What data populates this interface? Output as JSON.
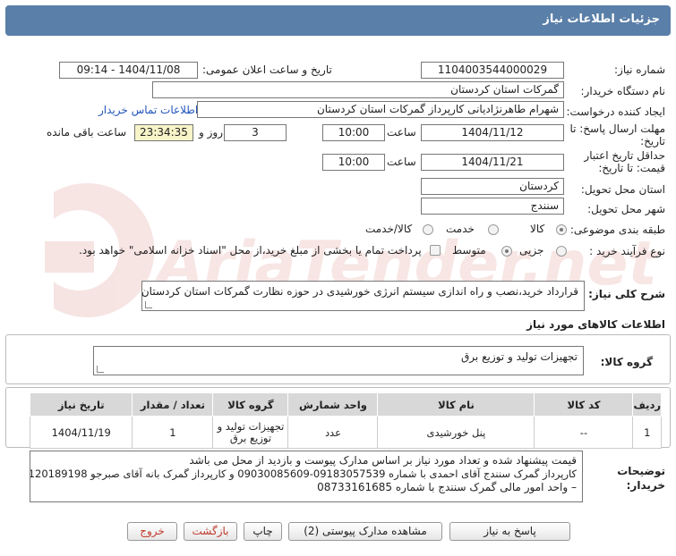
{
  "header": {
    "title": "جزئیات اطلاعات نیاز"
  },
  "form": {
    "need_number_label": "شماره نیاز:",
    "need_number": "1104003544000029",
    "announce_label": "تاریخ و ساعت اعلان عمومی:",
    "announce_value": "1404/11/08 - 09:14",
    "buyer_org_label": "نام دستگاه خریدار:",
    "buyer_org": "گمرکات استان کردستان",
    "creator_label": "ایجاد کننده درخواست:",
    "creator": "شهرام  طاهرنژادیانی کارپرداز گمرکات استان کردستان",
    "contact_link": "اطلاعات تماس خریدار",
    "deadline_label_1": "مهلت ارسال پاسخ: تا",
    "deadline_label_2": "تاریخ:",
    "deadline_date": "1404/11/12",
    "time_label": "ساعت",
    "deadline_time": "10:00",
    "days_value": "3",
    "days_label": "روز و",
    "remaining_value": "23:34:35",
    "remaining_label": "ساعت باقی مانده",
    "validity_label_1": "حداقل تاریخ اعتبار",
    "validity_label_2": "قیمت: تا تاریخ:",
    "validity_date": "1404/11/21",
    "validity_time": "10:00",
    "province_label": "استان محل تحویل:",
    "province": "کردستان",
    "city_label": "شهر محل تحویل:",
    "city": "سنندج",
    "category_label": "طبقه بندی موضوعی:",
    "category_options": [
      "کالا",
      "خدمت",
      "کالا/خدمت"
    ],
    "process_label": "نوع فرآیند خرید :",
    "process_options": [
      "جزیی",
      "متوسط"
    ],
    "payment_note": "پرداخت تمام یا بخشی از مبلغ خرید،از محل \"اسناد خزانه اسلامی\" خواهد بود."
  },
  "summary": {
    "label": "شرح کلی نیاز:",
    "text": "قرارداد خرید،نصب و راه اندازی سیستم انرژی خورشیدی در حوزه نظارت گمرکات استان کردستان و گمرک بانه"
  },
  "goods_info": {
    "title": "اطلاعات کالاهای مورد نیاز",
    "group_label": "گروه کالا:",
    "group_value": "تجهیزات تولید و توزیع برق"
  },
  "table": {
    "headers": [
      "ردیف",
      "کد کالا",
      "نام کالا",
      "واحد شمارش",
      "گروه کالا",
      "تعداد / مقدار",
      "تاریخ نیاز"
    ],
    "rows": [
      [
        "1",
        "--",
        "پنل خورشیدی",
        "عدد",
        "تجهیزات تولید و توزیع برق",
        "1",
        "1404/11/19"
      ]
    ]
  },
  "notes": {
    "label_1": "توضیحات",
    "label_2": "خریدار:",
    "line_1": "قیمت پیشنهاد شده و تعداد مورد نیاز بر اساس مدارک پیوست و بازدید از محل می باشد",
    "line_2": "کارپرداز گمرک سنندج آقای احمدی با شماره 09183057539-09030085609 و کارپرداز گمرک بانه  آقای صبرجو 09120189198",
    "line_3": "– واحد امور مالی گمرک سنندج با شماره 08733161685"
  },
  "buttons": {
    "reply": "پاسخ به نیاز",
    "attachments": "مشاهده مدارک پیوستی (2)",
    "print": "چاپ",
    "back": "بازگشت",
    "exit": "خروج"
  },
  "watermark": {
    "text": "AriaTender.net"
  },
  "colors": {
    "title_bar": "#5a7fa8",
    "link": "#2255bb",
    "remaining_bg": "#f7f4c8",
    "danger": "#c0392b"
  }
}
